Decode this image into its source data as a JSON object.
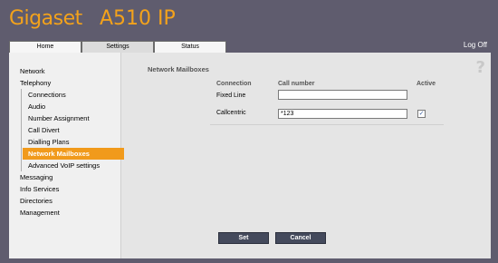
{
  "brand": {
    "logo": "Gigaset",
    "model": "A510 IP",
    "color": "#f3a21b"
  },
  "tabs": [
    {
      "label": "Home"
    },
    {
      "label": "Settings",
      "active": true
    },
    {
      "label": "Status"
    }
  ],
  "logoff_label": "Log Off",
  "sidebar": {
    "items": [
      {
        "label": "Network"
      },
      {
        "label": "Telephony"
      },
      {
        "label": "Connections"
      },
      {
        "label": "Audio"
      },
      {
        "label": "Number Assignment"
      },
      {
        "label": "Call Divert"
      },
      {
        "label": "Dialling Plans"
      },
      {
        "label": "Network Mailboxes",
        "selected": true
      },
      {
        "label": "Advanced VoIP settings"
      },
      {
        "label": "Messaging"
      },
      {
        "label": "Info Services"
      },
      {
        "label": "Directories"
      },
      {
        "label": "Management"
      }
    ]
  },
  "main": {
    "title": "Network Mailboxes",
    "help_icon": "help-icon",
    "columns": {
      "connection": "Connection",
      "call_number": "Call number",
      "active": "Active"
    },
    "rows": [
      {
        "label": "Fixed Line",
        "call_number": "",
        "active": false
      },
      {
        "label": "Callcentric",
        "call_number": "*123",
        "active": true
      }
    ]
  },
  "actions": {
    "set_label": "Set",
    "cancel_label": "Cancel"
  },
  "colors": {
    "accent": "#f19a1b",
    "background": "#5f5c6e",
    "panel": "#e5e5e5"
  }
}
